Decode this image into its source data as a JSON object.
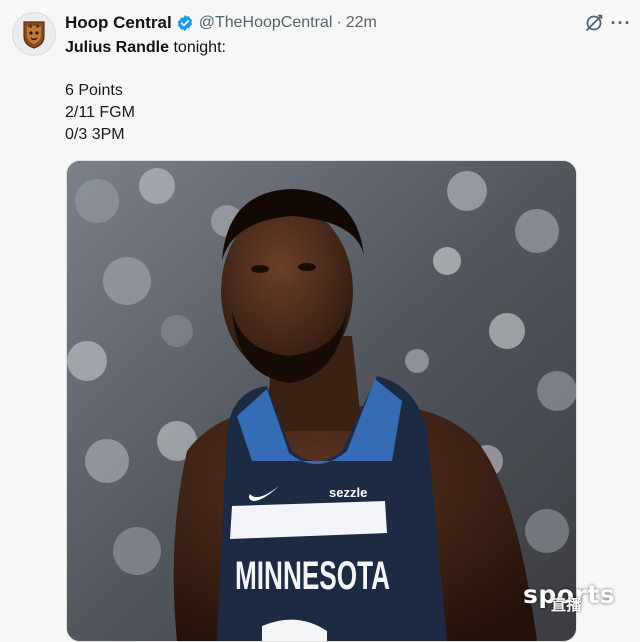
{
  "author": {
    "display_name": "Hoop Central",
    "handle": "@TheHoopCentral",
    "separator": "·",
    "timestamp": "22m",
    "avatar_icon": "hoop-central-logo",
    "verified_color": "#1d9bf0"
  },
  "tweet": {
    "lead_name": "Julius Randle",
    "lead_rest": " tonight:",
    "stats": [
      "6 Points",
      "2/11 FGM",
      "0/3 3PM"
    ]
  },
  "media": {
    "jersey_text": "MINNESOTA",
    "sponsor_text": "sezzle",
    "brand_icon": "nike-swoosh",
    "jersey_color": "#1d2a44",
    "accent_color": "#3a78c9"
  },
  "watermark": {
    "text": "sports",
    "sub": "直播"
  },
  "actions": {
    "grok_icon": "grok-icon",
    "more_label": "···"
  }
}
